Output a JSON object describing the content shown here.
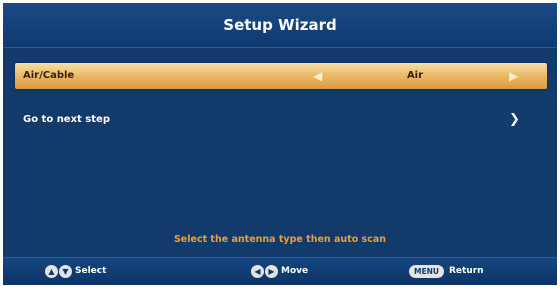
{
  "header": {
    "title": "Setup Wizard"
  },
  "menu": {
    "items": [
      {
        "label": "Air/Cable",
        "value": "Air",
        "selected": true
      },
      {
        "label": "Go to next step",
        "selected": false
      }
    ]
  },
  "hint": "Select the antenna type then auto scan",
  "footer": {
    "select_label": "Select",
    "move_label": "Move",
    "menu_key": "MENU",
    "return_label": "Return"
  },
  "icons": {
    "left_arrow": "◀",
    "right_arrow": "▶",
    "up_arrow": "▲",
    "down_arrow": "▼"
  },
  "colors": {
    "background": "#123a6b",
    "selected_row": "#e8b15d",
    "hint_text": "#e7a138"
  }
}
